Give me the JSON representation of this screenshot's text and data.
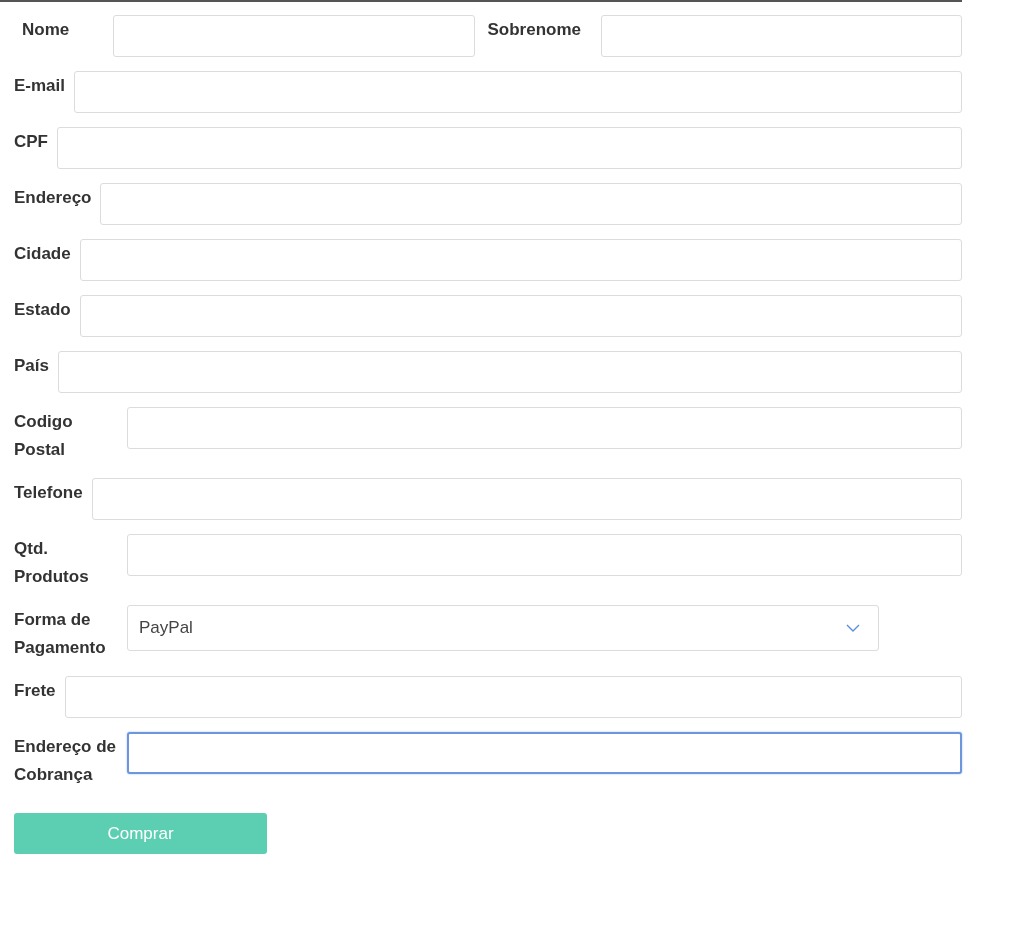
{
  "name_row": [
    {
      "label": "Nome",
      "focused": false
    },
    {
      "label": "Sobrenome",
      "focused": false
    }
  ],
  "fields": [
    {
      "kind": "text",
      "label": "E-mail",
      "focused": false
    },
    {
      "kind": "text",
      "label": "CPF",
      "focused": false
    },
    {
      "kind": "text",
      "label": "Endereço",
      "focused": false
    },
    {
      "kind": "text",
      "label": "Cidade",
      "focused": false
    },
    {
      "kind": "text",
      "label": "Estado",
      "focused": false
    },
    {
      "kind": "text",
      "label": "País",
      "focused": false
    },
    {
      "kind": "text",
      "label": "Codigo Postal",
      "focused": false
    },
    {
      "kind": "text",
      "label": "Telefone",
      "focused": false
    },
    {
      "kind": "text",
      "label": "Qtd. Produtos",
      "focused": false
    },
    {
      "kind": "select",
      "label": "Forma de Pagamento",
      "value": "PayPal",
      "focused": false
    },
    {
      "kind": "text",
      "label": "Frete",
      "focused": false
    },
    {
      "kind": "text",
      "label": "Endereço de Cobrança",
      "focused": true
    }
  ],
  "submit_button": "Comprar"
}
